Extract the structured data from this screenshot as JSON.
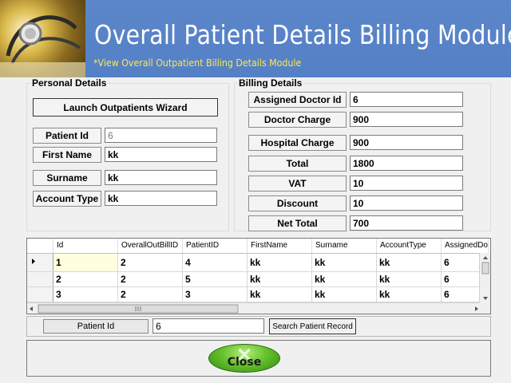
{
  "banner": {
    "title": "Overall Patient Details Billing Module",
    "subtitle": "*View Overall Outpatient Billing Details Module"
  },
  "personal": {
    "group_title": "Personal Details",
    "launch_wizard_label": "Launch Outpatients Wizard",
    "patient_id_label": "Patient Id",
    "patient_id_value": "6",
    "first_name_label": "First Name",
    "first_name_value": "kk",
    "surname_label": "Surname",
    "surname_value": "kk",
    "account_type_label": "Account Type",
    "account_type_value": "kk"
  },
  "billing": {
    "group_title": "Billing Details",
    "assigned_doctor_label": "Assigned Doctor Id",
    "assigned_doctor_value": "6",
    "doctor_charge_label": "Doctor Charge",
    "doctor_charge_value": "900",
    "hospital_charge_label": "Hospital Charge",
    "hospital_charge_value": "900",
    "total_label": "Total",
    "total_value": "1800",
    "vat_label": "VAT",
    "vat_value": "10",
    "discount_label": "Discount",
    "discount_value": "10",
    "net_total_label": "Net Total",
    "net_total_value": "700"
  },
  "grid": {
    "columns": [
      "Id",
      "OverallOutBillID",
      "PatientID",
      "FirstName",
      "Surname",
      "AccountType",
      "AssignedDo"
    ],
    "rows": [
      [
        "1",
        "2",
        "4",
        "kk",
        "kk",
        "kk",
        "6"
      ],
      [
        "2",
        "2",
        "5",
        "kk",
        "kk",
        "kk",
        "6"
      ],
      [
        "3",
        "2",
        "3",
        "kk",
        "kk",
        "kk",
        "6"
      ]
    ]
  },
  "search": {
    "patient_id_label": "Patient Id",
    "patient_id_value": "6",
    "button_label": "Search Patient Record"
  },
  "close": {
    "label": "Close"
  },
  "colors": {
    "banner": "#5480c6",
    "subtitle": "#ffe74d",
    "close_button": "#66c22c"
  },
  "icons": [
    "stethoscope-image",
    "row-selector-icon",
    "scroll-up-icon",
    "scroll-down-icon",
    "scroll-left-icon",
    "scroll-right-icon",
    "close-x-icon"
  ]
}
